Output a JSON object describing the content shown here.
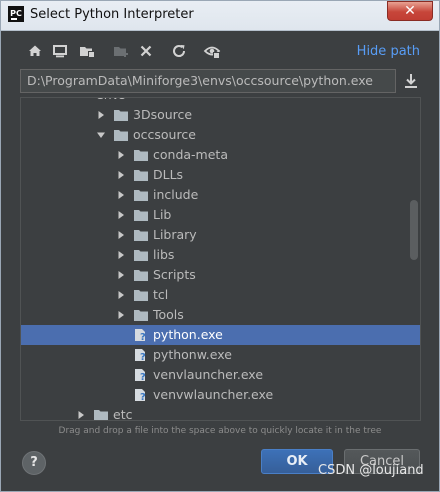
{
  "window": {
    "title": "Select Python Interpreter",
    "logo_text": "PC",
    "close_label": "✕"
  },
  "toolbar": {
    "icons": [
      "home-icon",
      "desktop-icon",
      "project-folder-icon",
      "new-folder-icon",
      "delete-icon",
      "refresh-icon",
      "show-hidden-icon"
    ],
    "hide_path_label": "Hide path"
  },
  "path_field": {
    "value": "D:\\ProgramData\\Miniforge3\\envs\\occsource\\python.exe"
  },
  "tree": {
    "top_partial_label": "envs",
    "rows": [
      {
        "label": "3Dsource",
        "type": "folder",
        "arrow": "right"
      },
      {
        "label": "occsource",
        "type": "folder",
        "arrow": "down"
      },
      {
        "label": "conda-meta",
        "type": "folder",
        "arrow": "right"
      },
      {
        "label": "DLLs",
        "type": "folder",
        "arrow": "right"
      },
      {
        "label": "include",
        "type": "folder",
        "arrow": "right"
      },
      {
        "label": "Lib",
        "type": "folder",
        "arrow": "right"
      },
      {
        "label": "Library",
        "type": "folder",
        "arrow": "right"
      },
      {
        "label": "libs",
        "type": "folder",
        "arrow": "right"
      },
      {
        "label": "Scripts",
        "type": "folder",
        "arrow": "right"
      },
      {
        "label": "tcl",
        "type": "folder",
        "arrow": "right"
      },
      {
        "label": "Tools",
        "type": "folder",
        "arrow": "right"
      },
      {
        "label": "python.exe",
        "type": "exe",
        "arrow": "none",
        "selected": true
      },
      {
        "label": "pythonw.exe",
        "type": "exe",
        "arrow": "none"
      },
      {
        "label": "venvlauncher.exe",
        "type": "exe",
        "arrow": "none"
      },
      {
        "label": "venvwlauncher.exe",
        "type": "exe",
        "arrow": "none"
      },
      {
        "label": "etc",
        "type": "folder",
        "arrow": "right"
      }
    ]
  },
  "hint": "Drag and drop a file into the space above to quickly locate it in the tree",
  "buttons": {
    "help_label": "?",
    "ok_label": "OK",
    "cancel_label": "Cancel"
  },
  "watermark": "CSDN @loujiand",
  "colors": {
    "background": "#3c3f41",
    "selection": "#4b6eaf",
    "link": "#589df6",
    "folder": "#aeb9c0"
  }
}
